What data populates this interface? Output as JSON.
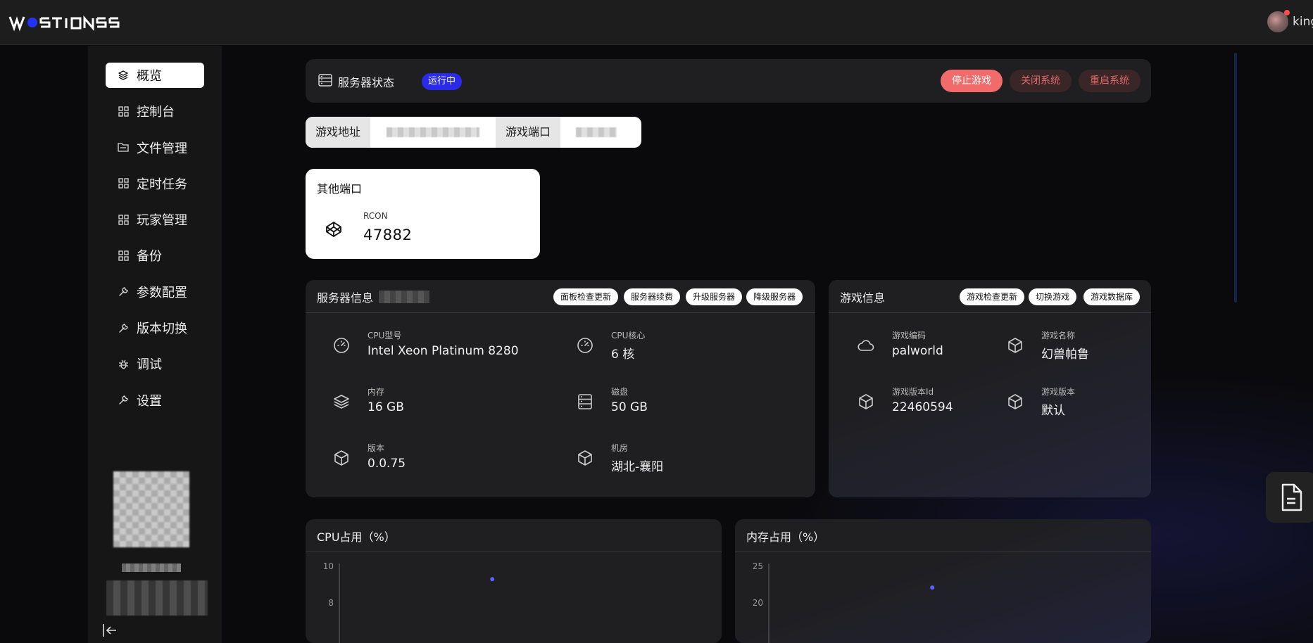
{
  "app": {
    "logo_text": "WOSTIONS",
    "username": "king"
  },
  "sidebar": {
    "items": [
      {
        "label": "概览",
        "icon": "layers-icon",
        "active": true
      },
      {
        "label": "控制台",
        "icon": "grid-icon"
      },
      {
        "label": "文件管理",
        "icon": "folder-icon"
      },
      {
        "label": "定时任务",
        "icon": "grid-icon"
      },
      {
        "label": "玩家管理",
        "icon": "grid-icon"
      },
      {
        "label": "备份",
        "icon": "grid-icon"
      },
      {
        "label": "参数配置",
        "icon": "wrench-icon"
      },
      {
        "label": "版本切换",
        "icon": "wrench-icon"
      },
      {
        "label": "调试",
        "icon": "bug-icon"
      },
      {
        "label": "设置",
        "icon": "wrench-icon"
      }
    ]
  },
  "status": {
    "title": "服务器状态",
    "badge": "运行中",
    "stop_label": "停止游戏",
    "shutdown_label": "关闭系统",
    "restart_label": "重启系统"
  },
  "address": {
    "addr_label": "游戏地址",
    "port_label": "游戏端口"
  },
  "ports": {
    "title": "其他端口",
    "rcon_label": "RCON",
    "rcon_value": "47882"
  },
  "server_info": {
    "title": "服务器信息",
    "buttons": [
      "面板检查更新",
      "服务器续费",
      "升级服务器",
      "降级服务器"
    ],
    "items": [
      {
        "label": "CPU型号",
        "value": "Intel Xeon Platinum 8280",
        "icon": "gauge-icon"
      },
      {
        "label": "CPU核心",
        "value": "6 核",
        "icon": "gauge-icon"
      },
      {
        "label": "内存",
        "value": "16 GB",
        "icon": "layers-icon"
      },
      {
        "label": "磁盘",
        "value": "50 GB",
        "icon": "disk-icon"
      },
      {
        "label": "版本",
        "value": "0.0.75",
        "icon": "cube-icon"
      },
      {
        "label": "机房",
        "value": "湖北-襄阳",
        "icon": "cube-icon"
      }
    ]
  },
  "game_info": {
    "title": "游戏信息",
    "buttons": [
      "游戏检查更新",
      "切换游戏",
      "游戏数据库"
    ],
    "items": [
      {
        "label": "游戏编码",
        "value": "palworld",
        "icon": "cloud-icon"
      },
      {
        "label": "游戏名称",
        "value": "幻兽帕鲁",
        "icon": "cube-icon"
      },
      {
        "label": "游戏版本Id",
        "value": "22460594",
        "icon": "cube-icon"
      },
      {
        "label": "游戏版本",
        "value": "默认",
        "icon": "cube-icon"
      }
    ]
  },
  "chart_data": [
    {
      "type": "line",
      "title": "CPU占用（%）",
      "yticks": [
        "10",
        "8"
      ],
      "ylim": [
        8,
        10
      ],
      "series": [
        {
          "values": [
            9.3
          ]
        }
      ],
      "point_color": "#5566ff"
    },
    {
      "type": "line",
      "title": "内存占用（%）",
      "yticks": [
        "25",
        "20"
      ],
      "ylim": [
        20,
        25
      ],
      "series": [
        {
          "values": [
            22.1
          ]
        }
      ],
      "point_color": "#5566ff"
    }
  ]
}
